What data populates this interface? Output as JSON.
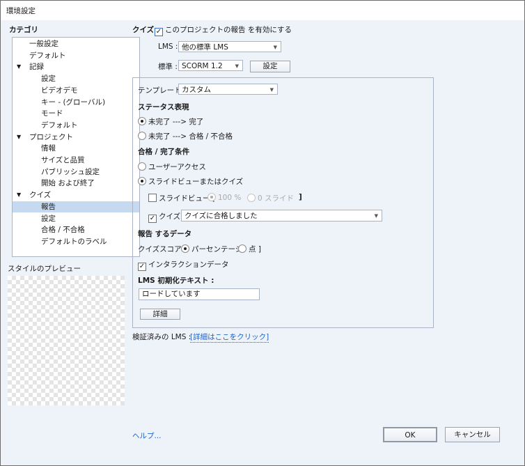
{
  "window": {
    "title": "環境設定"
  },
  "sidebar": {
    "heading": "カテゴリ",
    "items": [
      {
        "label": "一般設定",
        "level": 0,
        "arrow": ""
      },
      {
        "label": "デフォルト",
        "level": 0,
        "arrow": ""
      },
      {
        "label": "記録",
        "level": 0,
        "arrow": "▼"
      },
      {
        "label": "設定",
        "level": 1,
        "arrow": ""
      },
      {
        "label": "ビデオデモ",
        "level": 1,
        "arrow": ""
      },
      {
        "label": "キー - (グローバル)",
        "level": 1,
        "arrow": ""
      },
      {
        "label": "モード",
        "level": 1,
        "arrow": ""
      },
      {
        "label": "デフォルト",
        "level": 1,
        "arrow": ""
      },
      {
        "label": "プロジェクト",
        "level": 0,
        "arrow": "▼"
      },
      {
        "label": "情報",
        "level": 1,
        "arrow": ""
      },
      {
        "label": "サイズと品質",
        "level": 1,
        "arrow": ""
      },
      {
        "label": "パブリッシュ設定",
        "level": 1,
        "arrow": ""
      },
      {
        "label": "開始 および終了",
        "level": 1,
        "arrow": ""
      },
      {
        "label": "クイズ",
        "level": 0,
        "arrow": "▼"
      },
      {
        "label": "報告",
        "level": 1,
        "arrow": "",
        "selected": true
      },
      {
        "label": "設定",
        "level": 1,
        "arrow": ""
      },
      {
        "label": "合格 / 不合格",
        "level": 1,
        "arrow": ""
      },
      {
        "label": "デフォルトのラベル",
        "level": 1,
        "arrow": ""
      }
    ],
    "preview_label": "スタイルのプレビュー"
  },
  "main": {
    "quiz_label": "クイズ :",
    "enable_label": "このプロジェクトの報告 を有効にする",
    "lms_label": "LMS :",
    "lms_value": "他の標準 LMS",
    "standard_label": "標準 :",
    "standard_value": "SCORM 1.2",
    "settings_button": "設定",
    "template_label": "テンプレート :",
    "template_value": "カスタム",
    "status_heading": "ステータス表現",
    "status_opt1": "未完了 ---> 完了",
    "status_opt2": "未完了 ---> 合格 / 不合格",
    "criteria_heading": "合格 / 完了条件",
    "criteria_opt1": "ユーザーアクセス",
    "criteria_opt2": "スライドビューまたはクイズ",
    "slideview_label": "スライドビュー [",
    "slideview_pct": "100 %",
    "slideview_slides": "0 スライド",
    "bracket_close": "]",
    "quiz_check_label": "クイズ",
    "quiz_criteria_value": "クイズに合格しました",
    "data_heading": "報告 するデータ",
    "score_label": "クイズスコア [",
    "score_pct": "パーセンテージ",
    "score_points": "点 ]",
    "interaction_label": "インタラクションデータ",
    "init_text_label": "LMS 初期化テキスト :",
    "init_text_value": "ロードしています",
    "details_button": "詳細",
    "verified_label": "検証済みの LMS :",
    "verified_link": "[詳細はここをクリック]"
  },
  "footer": {
    "help": "ヘルプ...",
    "ok": "OK",
    "cancel": "キャンセル"
  },
  "colors": {
    "accent": "#1a63c9",
    "selection": "#c5d9f1",
    "background": "#eef2f9"
  }
}
